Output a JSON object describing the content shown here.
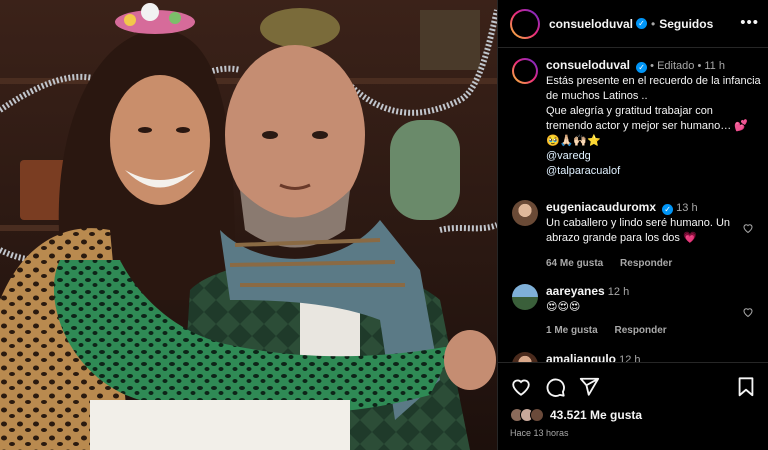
{
  "post": {
    "username": "consueloduval",
    "follow_status": "Seguidos",
    "more_label": "•••"
  },
  "caption": {
    "username": "consueloduval",
    "edited": "Editado",
    "age": "11 h",
    "text": "Estás presente en el recuerdo de la infancia de muchos Latinos ..\nQue alegría y gratitud trabajar con tremendo actor y mejor ser humano… 💕",
    "emojis": "🥹🙏🏻🙌🏻⭐",
    "mentions": [
      "@varedg",
      "@talparacualof"
    ]
  },
  "comments": [
    {
      "username": "eugeniacauduromx",
      "verified": true,
      "age": "13 h",
      "text": "Un caballero y lindo seré humano. Un abrazo grande para los dos 💗",
      "likes": "64 Me gusta",
      "reply": "Responder"
    },
    {
      "username": "aareyanes",
      "verified": false,
      "age": "12 h",
      "text": "😍😍😍",
      "likes": "1 Me gusta",
      "reply": "Responder"
    },
    {
      "username": "amaliangulo",
      "verified": false,
      "age": "12 h",
      "text": ""
    }
  ],
  "footer": {
    "likes": "43.521 Me gusta",
    "time_ago": "Hace 13 horas"
  },
  "icons": {
    "like": "heart-icon",
    "comment": "comment-icon",
    "share": "share-icon",
    "save": "bookmark-icon"
  },
  "colors": {
    "verified": "#0095f6",
    "background": "#000000",
    "secondary_text": "#a8a8a8"
  }
}
